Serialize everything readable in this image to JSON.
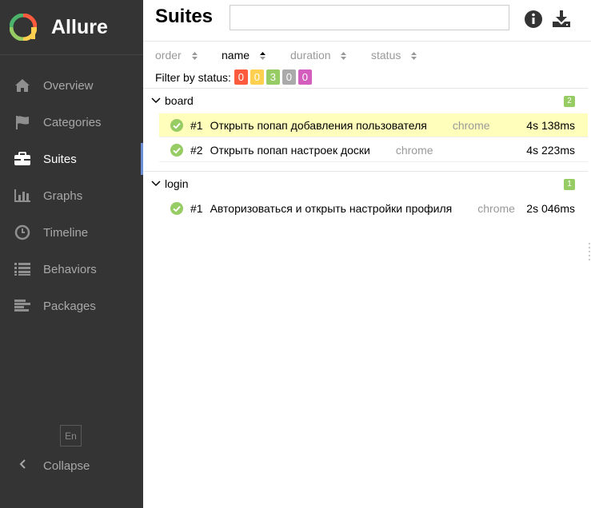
{
  "brand": {
    "name": "Allure"
  },
  "sidebar": {
    "items": [
      {
        "label": "Overview",
        "icon": "home-icon"
      },
      {
        "label": "Categories",
        "icon": "flag-icon"
      },
      {
        "label": "Suites",
        "icon": "briefcase-icon",
        "active": true
      },
      {
        "label": "Graphs",
        "icon": "bar-chart-icon"
      },
      {
        "label": "Timeline",
        "icon": "clock-icon"
      },
      {
        "label": "Behaviors",
        "icon": "list-icon"
      },
      {
        "label": "Packages",
        "icon": "align-left-icon"
      }
    ],
    "language": "En",
    "collapse_label": "Collapse"
  },
  "header": {
    "title": "Suites",
    "search": {
      "value": "",
      "placeholder": ""
    }
  },
  "sorters": [
    {
      "label": "order"
    },
    {
      "label": "name",
      "active": true
    },
    {
      "label": "duration"
    },
    {
      "label": "status"
    }
  ],
  "filter": {
    "label": "Filter by status:",
    "failed": "0",
    "broken": "0",
    "passed": "3",
    "skipped": "0",
    "unknown": "0"
  },
  "groups": [
    {
      "name": "board",
      "count": "2",
      "tests": [
        {
          "num": "#1",
          "name": "Открыть попап добавления пользователя",
          "tag": "chrome",
          "duration": "4s 138ms",
          "selected": true
        },
        {
          "num": "#2",
          "name": "Открыть попап настроек доски",
          "tag": "chrome",
          "duration": "4s 223ms"
        }
      ]
    },
    {
      "name": "login",
      "count": "1",
      "tests": [
        {
          "num": "#1",
          "name": "Авторизоваться и открыть настройки профиля",
          "tag": "chrome",
          "duration": "2s 046ms"
        }
      ]
    }
  ],
  "colors": {
    "failed": "#fd5a3e",
    "broken": "#ffd050",
    "passed": "#97cc64",
    "skipped": "#aaaaaa",
    "unknown": "#d35ebe",
    "sidebar_bg": "#343434",
    "selected_row": "#ffffbb"
  }
}
